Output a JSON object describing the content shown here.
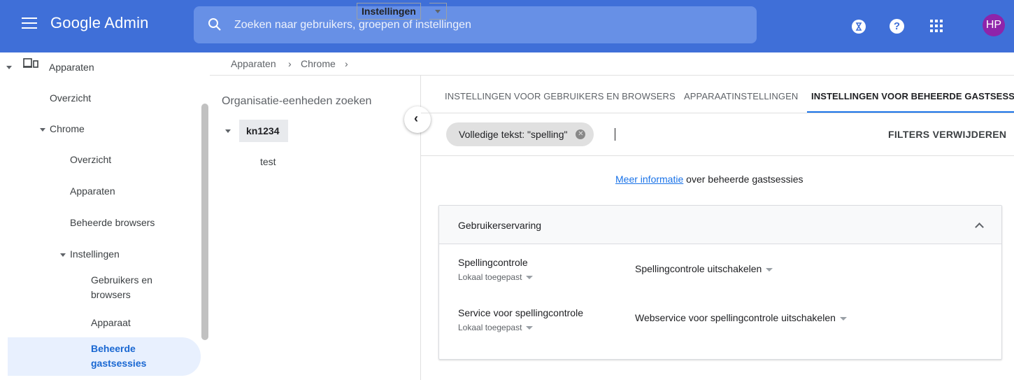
{
  "header": {
    "app_title": "Google Admin",
    "search_placeholder": "Zoeken naar gebruikers, groepen of instellingen",
    "avatar_initials": "HP",
    "brand_color": "#3f6fd8",
    "icons": [
      "menu-icon",
      "search-icon",
      "hourglass-icon",
      "help-icon",
      "apps-icon"
    ]
  },
  "sidebar": {
    "root": "Apparaten",
    "overview": "Overzicht",
    "chrome": "Chrome",
    "chrome_overview": "Overzicht",
    "chrome_devices": "Apparaten",
    "managed_browsers": "Beheerde browsers",
    "settings": "Instellingen",
    "users_browsers_line1": "Gebruikers en",
    "users_browsers_line2": "browsers",
    "device": "Apparaat",
    "guest_line1": "Beheerde",
    "guest_line2": "gastsessies"
  },
  "breadcrumb": {
    "items": [
      "Apparaten",
      "Chrome"
    ],
    "separator": "›",
    "current": "Instellingen"
  },
  "org_panel": {
    "search_label": "Organisatie-eenheden zoeken",
    "root_unit": "kn1234",
    "child_unit": "test"
  },
  "tabs": [
    {
      "label": "INSTELLINGEN VOOR GEBRUIKERS EN BROWSERS",
      "active": false
    },
    {
      "label": "APPARAATINSTELLINGEN",
      "active": false
    },
    {
      "label": "INSTELLINGEN VOOR BEHEERDE GASTSESSIES",
      "active": true
    }
  ],
  "filter": {
    "chip_label": "Volledige tekst: \"spelling\"",
    "clear_label": "FILTERS VERWIJDEREN"
  },
  "info": {
    "link_text": "Meer informatie",
    "rest_text": " over beheerde gastsessies"
  },
  "card": {
    "title": "Gebruikerservaring",
    "settings": [
      {
        "name": "Spellingcontrole",
        "scope": "Lokaal toegepast",
        "value": "Spellingcontrole uitschakelen"
      },
      {
        "name": "Service voor spellingcontrole",
        "scope": "Lokaal toegepast",
        "value": "Webservice voor spellingcontrole uitschakelen"
      }
    ]
  }
}
